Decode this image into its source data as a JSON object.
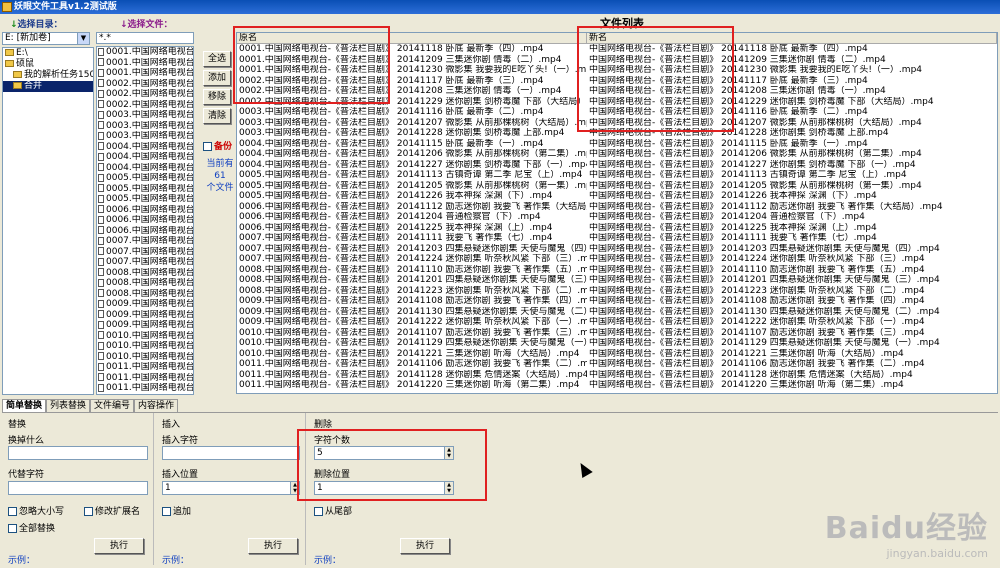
{
  "window": {
    "title": "妖眼文件工具v1.2测试版"
  },
  "labels": {
    "select_dir": "选择目录：",
    "select_file": "选择文件：",
    "arrow": "↓"
  },
  "drive": {
    "value": "E: [新加卷]"
  },
  "tree": [
    {
      "label": "E:\\",
      "selected": false,
      "indent": 0
    },
    {
      "label": "硕鼠",
      "selected": false,
      "indent": 0
    },
    {
      "label": "我的解析任务150",
      "selected": false,
      "indent": 1
    },
    {
      "label": "合并",
      "selected": true,
      "indent": 1
    }
  ],
  "file_filter": "*.*",
  "files": [
    "0001.中国网络电视台",
    "0001.中国网络电视台",
    "0001.中国网络电视台",
    "0002.中国网络电视台",
    "0002.中国网络电视台",
    "0002.中国网络电视台",
    "0003.中国网络电视台",
    "0003.中国网络电视台",
    "0003.中国网络电视台",
    "0004.中国网络电视台",
    "0004.中国网络电视台",
    "0004.中国网络电视台",
    "0005.中国网络电视台",
    "0005.中国网络电视台",
    "0005.中国网络电视台",
    "0006.中国网络电视台",
    "0006.中国网络电视台",
    "0006.中国网络电视台",
    "0007.中国网络电视台",
    "0007.中国网络电视台",
    "0007.中国网络电视台",
    "0008.中国网络电视台",
    "0008.中国网络电视台",
    "0008.中国网络电视台",
    "0009.中国网络电视台",
    "0009.中国网络电视台",
    "0009.中国网络电视台",
    "0010.中国网络电视台",
    "0010.中国网络电视台",
    "0010.中国网络电视台",
    "0011.中国网络电视台",
    "0011.中国网络电视台",
    "0011.中国网络电视台"
  ],
  "side_buttons": {
    "select_all": "全选",
    "add": "添加",
    "remove": "移除",
    "clear": "清除"
  },
  "backup_label": "备份",
  "current": {
    "line1": "当前有",
    "count": "61",
    "line2": "个文件"
  },
  "list_title": "文件列表",
  "columns": {
    "orig": "原名",
    "new": "新名"
  },
  "rows": [
    [
      "0001.中国网络电视台-《普法栏目剧》 20141118 卧底 最新季（四）.mp4",
      "中国网络电视台-《普法栏目剧》 20141118 卧底 最新季（四）.mp4"
    ],
    [
      "0001.中国网络电视台-《普法栏目剧》 20141209 三集迷你剧 情毒（二）.mp4",
      "中国网络电视台-《普法栏目剧》 20141209 三集迷你剧 情毒（二）.mp4"
    ],
    [
      "0001.中国网络电视台-《普法栏目剧》 20141230 微影集 我要我的E吃丫头!（一）.mp4",
      "中国网络电视台-《普法栏目剧》 20141230 微影集 我要我的E吃丫头!（一）.mp4"
    ],
    [
      "0002.中国网络电视台-《普法栏目剧》 20141117 卧底 最新季（三）.mp4",
      "中国网络电视台-《普法栏目剧》 20141117 卧底 最新季（三）.mp4"
    ],
    [
      "0002.中国网络电视台-《普法栏目剧》 20141208 三集迷你剧 情毒（一）.mp4",
      "中国网络电视台-《普法栏目剧》 20141208 三集迷你剧 情毒（一）.mp4"
    ],
    [
      "0002.中国网络电视台-《普法栏目剧》 20141229 迷你剧集 剑桥毒魔 下部（大结局）.mp4",
      "中国网络电视台-《普法栏目剧》 20141229 迷你剧集 剑桥毒魔 下部（大结局）.mp4"
    ],
    [
      "0003.中国网络电视台-《普法栏目剧》 20141116 卧底 最新季（二）.mp4",
      "中国网络电视台-《普法栏目剧》 20141116 卧底 最新季（二）.mp4"
    ],
    [
      "0003.中国网络电视台-《普法栏目剧》 20141207 微影集 从前那棵桃树（大结局）.mp4",
      "中国网络电视台-《普法栏目剧》 20141207 微影集 从前那棵桃树（大结局）.mp4"
    ],
    [
      "0003.中国网络电视台-《普法栏目剧》 20141228 迷你剧集 剑桥毒魔 上部.mp4",
      "中国网络电视台-《普法栏目剧》 20141228 迷你剧集 剑桥毒魔 上部.mp4"
    ],
    [
      "0004.中国网络电视台-《普法栏目剧》 20141115 卧底 最新季（一）.mp4",
      "中国网络电视台-《普法栏目剧》 20141115 卧底 最新季（一）.mp4"
    ],
    [
      "0004.中国网络电视台-《普法栏目剧》 20141206 微影集 从前那棵桃树（第二集）.mp4",
      "中国网络电视台-《普法栏目剧》 20141206 微影集 从前那棵桃树（第二集）.mp4"
    ],
    [
      "0004.中国网络电视台-《普法栏目剧》 20141227 迷你剧集 剑桥毒魔 下部（一）.mp4",
      "中国网络电视台-《普法栏目剧》 20141227 迷你剧集 剑桥毒魔 下部（一）.mp4"
    ],
    [
      "0005.中国网络电视台-《普法栏目剧》 20141113 古镇奇谭 第二季 尼宝（上）.mp4",
      "中国网络电视台-《普法栏目剧》 20141113 古镇奇谭 第二季 尼宝（上）.mp4"
    ],
    [
      "0005.中国网络电视台-《普法栏目剧》 20141205 微影集 从前那棵桃树（第一集）.mp4",
      "中国网络电视台-《普法栏目剧》 20141205 微影集 从前那棵桃树（第一集）.mp4"
    ],
    [
      "0005.中国网络电视台-《普法栏目剧》 20141226 我本神探 深渊（下）.mp4",
      "中国网络电视台-《普法栏目剧》 20141226 我本神探 深渊（下）.mp4"
    ],
    [
      "0006.中国网络电视台-《普法栏目剧》 20141112 励志迷你剧 我要飞 著作集（大结局）.mp4",
      "中国网络电视台-《普法栏目剧》 20141112 励志迷你剧 我要飞 著作集（大结局）.mp4"
    ],
    [
      "0006.中国网络电视台-《普法栏目剧》 20141204 普通检察官（下）.mp4",
      "中国网络电视台-《普法栏目剧》 20141204 普通检察官（下）.mp4"
    ],
    [
      "0006.中国网络电视台-《普法栏目剧》 20141225 我本神探 深渊（上）.mp4",
      "中国网络电视台-《普法栏目剧》 20141225 我本神探 深渊（上）.mp4"
    ],
    [
      "0007.中国网络电视台-《普法栏目剧》 20141111 我要飞 著作集（七）.mp4",
      "中国网络电视台-《普法栏目剧》 20141111 我要飞 著作集（七）.mp4"
    ],
    [
      "0007.中国网络电视台-《普法栏目剧》 20141203 四集悬疑迷你剧集 天使与魔鬼（四）.mp4",
      "中国网络电视台-《普法栏目剧》 20141203 四集悬疑迷你剧集 天使与魔鬼（四）.mp4"
    ],
    [
      "0007.中国网络电视台-《普法栏目剧》 20141224 迷你剧集 听奈秋风紧 下部（三）.mp4",
      "中国网络电视台-《普法栏目剧》 20141224 迷你剧集 听奈秋风紧 下部（三）.mp4"
    ],
    [
      "0008.中国网络电视台-《普法栏目剧》 20141110 励志迷你剧 我要飞 著作集（五）.mp4",
      "中国网络电视台-《普法栏目剧》 20141110 励志迷你剧 我要飞 著作集（五）.mp4"
    ],
    [
      "0008.中国网络电视台-《普法栏目剧》 20141201 四集悬疑迷你剧集 天使与魔鬼（三）.mp4",
      "中国网络电视台-《普法栏目剧》 20141201 四集悬疑迷你剧集 天使与魔鬼（三）.mp4"
    ],
    [
      "0008.中国网络电视台-《普法栏目剧》 20141223 迷你剧集 听奈秋风紧 下部（二）.mp4",
      "中国网络电视台-《普法栏目剧》 20141223 迷你剧集 听奈秋风紧 下部（二）.mp4"
    ],
    [
      "0009.中国网络电视台-《普法栏目剧》 20141108 励志迷你剧 我要飞 著作集（四）.mp4",
      "中国网络电视台-《普法栏目剧》 20141108 励志迷你剧 我要飞 著作集（四）.mp4"
    ],
    [
      "0009.中国网络电视台-《普法栏目剧》 20141130 四集悬疑迷你剧集 天使与魔鬼（二）.mp4",
      "中国网络电视台-《普法栏目剧》 20141130 四集悬疑迷你剧集 天使与魔鬼（二）.mp4"
    ],
    [
      "0009.中国网络电视台-《普法栏目剧》 20141222 迷你剧集 听奈秋风紧 下部（一）.mp4",
      "中国网络电视台-《普法栏目剧》 20141222 迷你剧集 听奈秋风紧 下部（一）.mp4"
    ],
    [
      "0010.中国网络电视台-《普法栏目剧》 20141107 励志迷你剧 我要飞 著作集（三）.mp4",
      "中国网络电视台-《普法栏目剧》 20141107 励志迷你剧 我要飞 著作集（三）.mp4"
    ],
    [
      "0010.中国网络电视台-《普法栏目剧》 20141129 四集悬疑迷你剧集 天使与魔鬼（一）.mp4",
      "中国网络电视台-《普法栏目剧》 20141129 四集悬疑迷你剧集 天使与魔鬼（一）.mp4"
    ],
    [
      "0010.中国网络电视台-《普法栏目剧》 20141221 三集迷你剧 听海（大结局）.mp4",
      "中国网络电视台-《普法栏目剧》 20141221 三集迷你剧 听海（大结局）.mp4"
    ],
    [
      "0011.中国网络电视台-《普法栏目剧》 20141106 励志迷你剧 我要飞 著作集（二）.mp4",
      "中国网络电视台-《普法栏目剧》 20141106 励志迷你剧 我要飞 著作集（二）.mp4"
    ],
    [
      "0011.中国网络电视台-《普法栏目剧》 20141128 迷你剧集 危情迷案（大结局）.mp4",
      "中国网络电视台-《普法栏目剧》 20141128 迷你剧集 危情迷案（大结局）.mp4"
    ],
    [
      "0011.中国网络电视台-《普法栏目剧》 20141220 三集迷你剧 听海（第二集）.mp4",
      "中国网络电视台-《普法栏目剧》 20141220 三集迷你剧 听海（第二集）.mp4"
    ]
  ],
  "tabs": [
    "简单替换",
    "列表替换",
    "文件编号",
    "内容操作"
  ],
  "replace": {
    "title": "替换",
    "what_label": "换掉什么",
    "with_label": "代替字符",
    "ignore_case": "忽略大小写",
    "modify_ext": "修改扩展名",
    "replace_all": "全部替换",
    "run": "执行",
    "example": "示例："
  },
  "insert": {
    "title": "插入",
    "char_label": "插入字符",
    "pos_label": "插入位置",
    "pos_value": "1",
    "append": "追加",
    "run": "执行",
    "example": "示例："
  },
  "delete": {
    "title": "删除",
    "count_label": "字符个数",
    "count_value": "5",
    "pos_label": "删除位置",
    "pos_value": "1",
    "from_end": "从尾部",
    "run": "执行",
    "example": "示例："
  },
  "watermark": {
    "brand": "Baidu经验",
    "url": "jingyan.baidu.com"
  },
  "colors": {
    "highlight_box": "#e02020",
    "title_gradient": "#0a4fb5",
    "hint_text": "#1040c0"
  }
}
